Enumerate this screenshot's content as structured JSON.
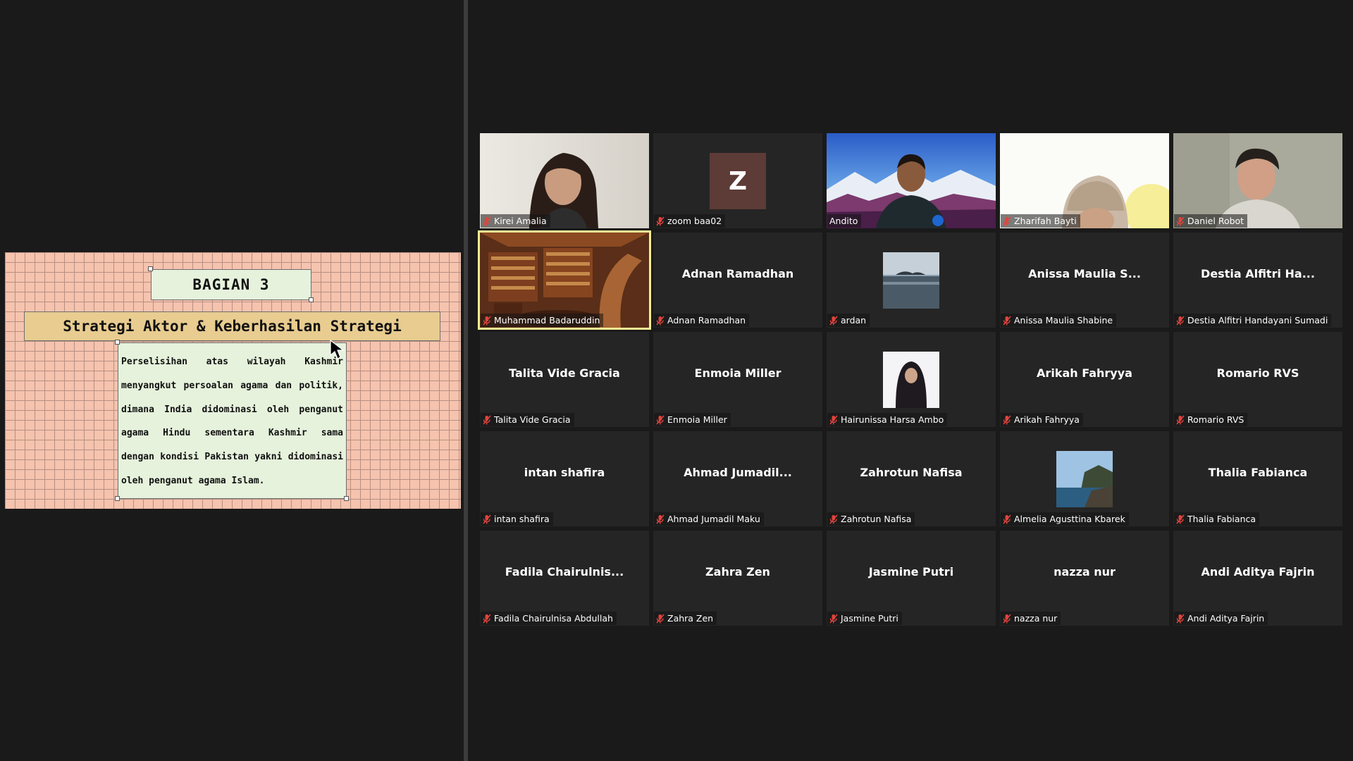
{
  "slide": {
    "title": "BAGIAN 3",
    "subtitle": "Strategi Aktor & Keberhasilan Strategi",
    "body": "Perselisihan atas wilayah Kashmir menyangkut persoalan agama dan politik, dimana India didominasi oleh penganut agama Hindu sementara Kashmir sama dengan kondisi Pakistan yakni didominasi oleh penganut agama Islam."
  },
  "participants": [
    {
      "label": "Kirei Amalia",
      "display": "",
      "kind": "video-girl",
      "muted": true
    },
    {
      "label": "zoom baa02",
      "display": "",
      "kind": "avatar-z",
      "avatar_letter": "Z",
      "muted": true
    },
    {
      "label": "Andito",
      "display": "",
      "kind": "video-mountain",
      "muted": false
    },
    {
      "label": "Zharifah Bayti",
      "display": "",
      "kind": "video-hijab",
      "muted": true
    },
    {
      "label": "Daniel Robot",
      "display": "",
      "kind": "video-man",
      "muted": true
    },
    {
      "label": "Muhammad Badaruddin",
      "display": "",
      "kind": "video-library",
      "muted": true,
      "active": true
    },
    {
      "label": "Adnan Ramadhan",
      "display": "Adnan Ramadhan",
      "kind": "name",
      "muted": true
    },
    {
      "label": "ardan",
      "display": "",
      "kind": "photo-sea",
      "muted": true
    },
    {
      "label": "Anissa Maulia Shabine",
      "display": "Anissa  Maulia  S...",
      "kind": "name",
      "muted": true
    },
    {
      "label": "Destia Alfitri Handayani Sumadi",
      "display": "Destia  Alfitri  Ha...",
      "kind": "name",
      "muted": true
    },
    {
      "label": "Talita Vide Gracia",
      "display": "Talita Vide Gracia",
      "kind": "name",
      "muted": true
    },
    {
      "label": "Enmoia Miller",
      "display": "Enmoia Miller",
      "kind": "name",
      "muted": true
    },
    {
      "label": "Hairunissa Harsa Ambo",
      "display": "",
      "kind": "photo-hijab",
      "muted": true
    },
    {
      "label": "Arikah Fahryya",
      "display": "Arikah Fahryya",
      "kind": "name",
      "muted": true
    },
    {
      "label": "Romario RVS",
      "display": "Romario RVS",
      "kind": "name",
      "muted": true
    },
    {
      "label": "intan shafira",
      "display": "intan shafira",
      "kind": "name",
      "muted": true
    },
    {
      "label": "Ahmad Jumadil Maku",
      "display": "Ahmad  Jumadil...",
      "kind": "name",
      "muted": true
    },
    {
      "label": "Zahrotun Nafisa",
      "display": "Zahrotun Nafisa",
      "kind": "name",
      "muted": true
    },
    {
      "label": "Almelia Agusttina Kbarek",
      "display": "",
      "kind": "photo-coast",
      "muted": true
    },
    {
      "label": "Thalia Fabianca",
      "display": "Thalia Fabianca",
      "kind": "name",
      "muted": true
    },
    {
      "label": "Fadila Chairulnisa Abdullah",
      "display": "Fadila  Chairulnis...",
      "kind": "name",
      "muted": true
    },
    {
      "label": "Zahra Zen",
      "display": "Zahra Zen",
      "kind": "name",
      "muted": true
    },
    {
      "label": "Jasmine Putri",
      "display": "Jasmine Putri",
      "kind": "name",
      "muted": true
    },
    {
      "label": "nazza nur",
      "display": "nazza nur",
      "kind": "name",
      "muted": true
    },
    {
      "label": "Andi Aditya Fajrin",
      "display": "Andi Aditya Fajrin",
      "kind": "name",
      "muted": true
    }
  ],
  "colors": {
    "background": "#1a1a1a",
    "tile": "#252525",
    "active_border": "#f1ee95",
    "muted_icon": "#e0443d",
    "slide_bg": "#f5c3ae",
    "slide_title_bg": "#e6f2dc",
    "slide_subtitle_bg": "#e8cc90"
  }
}
